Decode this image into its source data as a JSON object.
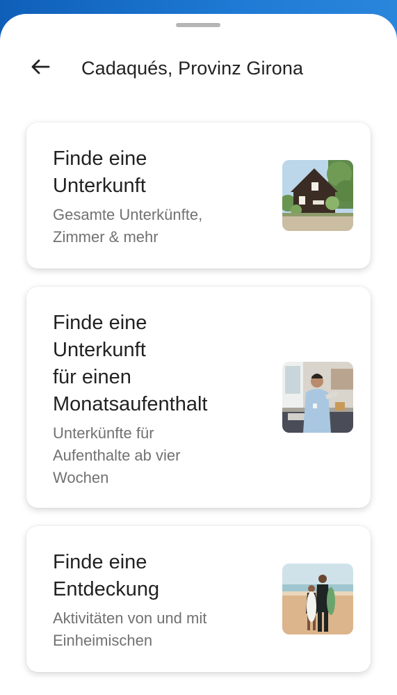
{
  "header": {
    "title": "Cadaqués, Provinz Girona",
    "back_icon": "arrow-left-icon"
  },
  "cards": [
    {
      "title_lines": [
        "Finde eine",
        "Unterkunft"
      ],
      "subtitle_lines": [
        "Gesamte Unterkünfte,",
        "Zimmer & mehr"
      ],
      "image": "house-photo"
    },
    {
      "title_lines": [
        "Finde eine",
        "Unterkunft",
        "für einen",
        "Monatsaufenthalt"
      ],
      "subtitle_lines": [
        "Unterkünfte für",
        "Aufenthalte ab vier",
        "Wochen"
      ],
      "image": "kitchen-man-photo"
    },
    {
      "title_lines": [
        "Finde eine",
        "Entdeckung"
      ],
      "subtitle_lines": [
        "Aktivitäten von und mit",
        "Einheimischen"
      ],
      "image": "surfers-beach-photo"
    }
  ],
  "colors": {
    "backdrop": "#1a73c8",
    "title_text": "#222222",
    "subtitle_text": "#717171",
    "handle": "#b5b5b5"
  }
}
